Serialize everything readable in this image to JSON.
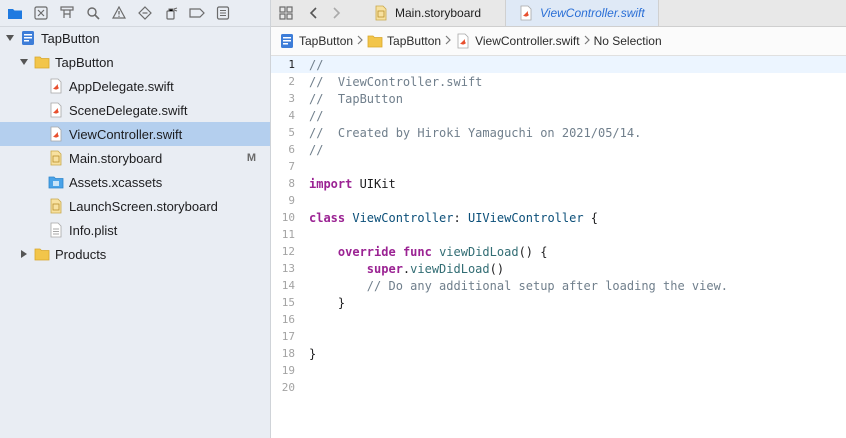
{
  "navigator": {
    "toolbar_icons": [
      "folder-icon",
      "xmark-square-icon",
      "hierarchy-icon",
      "search-icon",
      "warning-icon",
      "diamond-icon",
      "debug-spray-icon",
      "breakpoint-icon",
      "report-icon"
    ],
    "tree": [
      {
        "label": "TapButton",
        "level": 0,
        "kind": "project",
        "expanded": true
      },
      {
        "label": "TapButton",
        "level": 1,
        "kind": "folder",
        "expanded": true
      },
      {
        "label": "AppDelegate.swift",
        "level": 2,
        "kind": "swift"
      },
      {
        "label": "SceneDelegate.swift",
        "level": 2,
        "kind": "swift"
      },
      {
        "label": "ViewController.swift",
        "level": 2,
        "kind": "swift",
        "selected": true
      },
      {
        "label": "Main.storyboard",
        "level": 2,
        "kind": "storyboard",
        "badge": "M"
      },
      {
        "label": "Assets.xcassets",
        "level": 2,
        "kind": "assets"
      },
      {
        "label": "LaunchScreen.storyboard",
        "level": 2,
        "kind": "storyboard"
      },
      {
        "label": "Info.plist",
        "level": 2,
        "kind": "plist"
      },
      {
        "label": "Products",
        "level": 1,
        "kind": "folder",
        "expanded": false
      }
    ]
  },
  "tabs": [
    {
      "label": "Main.storyboard",
      "kind": "storyboard",
      "active": false
    },
    {
      "label": "ViewController.swift",
      "kind": "swift",
      "active": true
    }
  ],
  "jumpbar": {
    "items": [
      "TapButton",
      "TapButton",
      "ViewController.swift",
      "No Selection"
    ]
  },
  "editor": {
    "current_line": 1,
    "lines": [
      [
        [
          "t-comment",
          "//"
        ]
      ],
      [
        [
          "t-comment",
          "//  ViewController.swift"
        ]
      ],
      [
        [
          "t-comment",
          "//  TapButton"
        ]
      ],
      [
        [
          "t-comment",
          "//"
        ]
      ],
      [
        [
          "t-comment",
          "//  Created by Hiroki Yamaguchi on 2021/05/14."
        ]
      ],
      [
        [
          "t-comment",
          "//"
        ]
      ],
      [],
      [
        [
          "t-keyword",
          "import"
        ],
        [
          "t-plain",
          " UIKit"
        ]
      ],
      [],
      [
        [
          "t-keyword",
          "class"
        ],
        [
          "t-plain",
          " "
        ],
        [
          "t-type",
          "ViewController"
        ],
        [
          "t-plain",
          ": "
        ],
        [
          "t-type",
          "UIViewController"
        ],
        [
          "t-plain",
          " {"
        ]
      ],
      [],
      [
        [
          "t-plain",
          "    "
        ],
        [
          "t-keyword",
          "override"
        ],
        [
          "t-plain",
          " "
        ],
        [
          "t-keyword",
          "func"
        ],
        [
          "t-plain",
          " "
        ],
        [
          "t-func",
          "viewDidLoad"
        ],
        [
          "t-plain",
          "() {"
        ]
      ],
      [
        [
          "t-plain",
          "        "
        ],
        [
          "t-keyword",
          "super"
        ],
        [
          "t-plain",
          "."
        ],
        [
          "t-func",
          "viewDidLoad"
        ],
        [
          "t-plain",
          "()"
        ]
      ],
      [
        [
          "t-plain",
          "        "
        ],
        [
          "t-comment",
          "// Do any additional setup after loading the view."
        ]
      ],
      [
        [
          "t-plain",
          "    }"
        ]
      ],
      [],
      [],
      [
        [
          "t-plain",
          "}"
        ]
      ],
      [],
      []
    ]
  },
  "colors": {
    "accent": "#2a6fd6",
    "selection": "#b4cfee",
    "keyword": "#9b2393",
    "comment": "#707f8c",
    "type": "#0b4f79"
  }
}
